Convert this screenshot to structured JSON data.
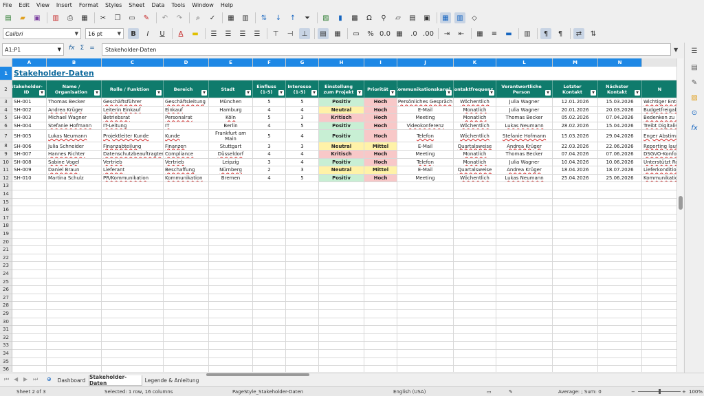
{
  "menu": [
    "File",
    "Edit",
    "View",
    "Insert",
    "Format",
    "Styles",
    "Sheet",
    "Data",
    "Tools",
    "Window",
    "Help"
  ],
  "toolbar": {
    "font_name": "Calibri",
    "font_size": "16 pt"
  },
  "formula_bar": {
    "cell_ref": "A1:P1",
    "content": "Stakeholder-Daten"
  },
  "columns": [
    "A",
    "B",
    "C",
    "D",
    "E",
    "F",
    "G",
    "H",
    "I",
    "J",
    "K",
    "L",
    "M",
    "N"
  ],
  "title": "Stakeholder-Daten",
  "headers": [
    "Stakeholder-ID",
    "Name / Organisation",
    "Rolle / Funktion",
    "Bereich",
    "Stadt",
    "Einfluss (1-5)",
    "Interesse (1-5)",
    "Einstellung zum Projekt",
    "Priorität",
    "Kommunikationskanal",
    "Kontaktfrequenz",
    "Verantwortliche Person",
    "Letzter Kontakt",
    "Nächster Kontakt",
    "N"
  ],
  "rows": [
    [
      "SH-001",
      "Thomas Becker",
      "Geschäftsführer",
      "Geschäftsleitung",
      "München",
      "5",
      "5",
      "Positiv",
      "Hoch",
      "Persönliches Gespräch",
      "Wöchentlich",
      "Julia Wagner",
      "12.01.2026",
      "15.03.2026",
      "Wichtiger Ents"
    ],
    [
      "SH-002",
      "Andrea Krüger",
      "Leiterin Einkauf",
      "Einkauf",
      "Hamburg",
      "4",
      "4",
      "Neutral",
      "Hoch",
      "E-Mail",
      "Monatlich",
      "Julia Wagner",
      "20.01.2026",
      "20.03.2026",
      "Budgetfreigabe"
    ],
    [
      "SH-003",
      "Michael Wagner",
      "Betriebsrat",
      "Personalrat",
      "Köln",
      "5",
      "3",
      "Kritisch",
      "Hoch",
      "Meeting",
      "Monatlich",
      "Thomas Becker",
      "05.02.2026",
      "07.04.2026",
      "Bedenken zu P"
    ],
    [
      "SH-004",
      "Stefanie Hofmann",
      "IT-Leitung",
      "IT",
      "Berlin",
      "4",
      "5",
      "Positiv",
      "Hoch",
      "Videokonferenz",
      "Wöchentlich",
      "Lukas Neumann",
      "28.02.2026",
      "15.04.2026",
      "Treibt Digitalis"
    ],
    [
      "SH-005",
      "Lukas Neumann",
      "Projektleiter Kunde",
      "Kunde",
      "Frankfurt am Main",
      "5",
      "4",
      "Positiv",
      "Hoch",
      "Telefon",
      "Wöchentlich",
      "Stefanie Hofmann",
      "15.03.2026",
      "29.04.2026",
      "Enger Abstimm"
    ],
    [
      "SH-006",
      "Julia Schneider",
      "Finanzabteilung",
      "Finanzen",
      "Stuttgart",
      "3",
      "3",
      "Neutral",
      "Mittel",
      "E-Mail",
      "Quartalsweise",
      "Andrea Krüger",
      "22.03.2026",
      "22.06.2026",
      "Reporting lauf"
    ],
    [
      "SH-007",
      "Hannes Richter",
      "Datenschutzbeauftragter",
      "Compliance",
      "Düsseldorf",
      "4",
      "4",
      "Kritisch",
      "Hoch",
      "Meeting",
      "Monatlich",
      "Thomas Becker",
      "07.04.2026",
      "07.06.2026",
      "DSGVO-Konfor"
    ],
    [
      "SH-008",
      "Sabine Vogel",
      "Vertrieb",
      "Vertrieb",
      "Leipzig",
      "3",
      "4",
      "Positiv",
      "Hoch",
      "Telefon",
      "Monatlich",
      "Julia Wagner",
      "10.04.2026",
      "10.06.2026",
      "Unterstützt Rol"
    ],
    [
      "SH-009",
      "Daniel Braun",
      "Lieferant",
      "Beschaffung",
      "Nürnberg",
      "2",
      "3",
      "Neutral",
      "Mittel",
      "E-Mail",
      "Quartalsweise",
      "Andrea Krüger",
      "18.04.2026",
      "18.07.2026",
      "Lieferkondition"
    ],
    [
      "SH-010",
      "Martina Schulz",
      "PR/Kommunikation",
      "Kommunikation",
      "Bremen",
      "4",
      "5",
      "Positiv",
      "Hoch",
      "Meeting",
      "Wöchentlich",
      "Lukas Neumann",
      "25.04.2026",
      "25.06.2026",
      "Kommunikation"
    ]
  ],
  "tabs": [
    "Dashboard",
    "Stakeholder-Daten",
    "Legende & Anleitung"
  ],
  "status": {
    "sheet": "Sheet 2 of 3",
    "selection": "Selected: 1 row, 16 columns",
    "page_style": "PageStyle_Stakeholder-Daten",
    "language": "English (USA)",
    "summary": "Average: ; Sum: 0",
    "zoom": "100%"
  },
  "colors": {
    "header_green": "#0f7b6c",
    "positiv": "#c8efd4",
    "neutral": "#fff2a8",
    "kritisch": "#f8c8c8",
    "hoch": "#f8c8c8",
    "mittel": "#fff2a8",
    "col_header_blue": "#1e88e5"
  }
}
